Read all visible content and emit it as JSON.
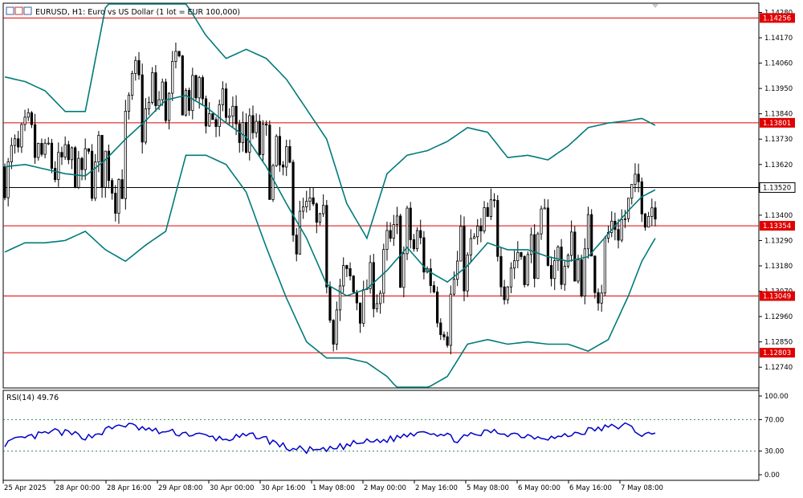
{
  "chart_data": {
    "type": "candlestick",
    "title": "EURUSD, H1:  Euro vs US Dollar (1 lot = EUR 100,000)",
    "price_axis": {
      "ylim": [
        1.1265,
        1.1432
      ],
      "ticks": [
        "1.14280",
        "1.14170",
        "1.14060",
        "1.13950",
        "1.13840",
        "1.13730",
        "1.13620",
        "1.13400",
        "1.13290",
        "1.13180",
        "1.13070",
        "1.12960",
        "1.12850",
        "1.12740"
      ]
    },
    "current_price": {
      "value": 1.1352,
      "label": "1.13520",
      "color": "#000000"
    },
    "horizontal_levels": [
      {
        "value": 1.14256,
        "label": "1.14256"
      },
      {
        "value": 1.13801,
        "label": "1.13801"
      },
      {
        "value": 1.13354,
        "label": "1.13354"
      },
      {
        "value": 1.13049,
        "label": "1.13049"
      },
      {
        "value": 1.12803,
        "label": "1.12803"
      }
    ],
    "level_color": "#e00000",
    "bollinger_color": "#007a7a",
    "bollinger_bands": {
      "middle": [
        [
          0,
          1.1361
        ],
        [
          6,
          1.1362
        ],
        [
          12,
          1.136
        ],
        [
          18,
          1.1358
        ],
        [
          24,
          1.1357
        ],
        [
          30,
          1.1364
        ],
        [
          36,
          1.1373
        ],
        [
          42,
          1.1381
        ],
        [
          48,
          1.139
        ],
        [
          54,
          1.1392
        ],
        [
          60,
          1.1387
        ],
        [
          66,
          1.138
        ],
        [
          72,
          1.1374
        ],
        [
          78,
          1.1361
        ],
        [
          84,
          1.1345
        ],
        [
          90,
          1.133
        ],
        [
          96,
          1.131
        ],
        [
          102,
          1.1305
        ],
        [
          108,
          1.1308
        ],
        [
          114,
          1.1316
        ],
        [
          120,
          1.1326
        ],
        [
          126,
          1.1316
        ],
        [
          132,
          1.1311
        ],
        [
          138,
          1.1318
        ],
        [
          144,
          1.1328
        ],
        [
          150,
          1.1325
        ],
        [
          156,
          1.1325
        ],
        [
          162,
          1.1322
        ],
        [
          168,
          1.132
        ],
        [
          174,
          1.1322
        ],
        [
          180,
          1.1332
        ],
        [
          186,
          1.1342
        ],
        [
          190,
          1.1348
        ],
        [
          194,
          1.1351
        ]
      ],
      "upper": [
        [
          0,
          1.14
        ],
        [
          6,
          1.1398
        ],
        [
          12,
          1.1394
        ],
        [
          18,
          1.1385
        ],
        [
          24,
          1.1385
        ],
        [
          30,
          1.143
        ],
        [
          36,
          1.1446
        ],
        [
          42,
          1.1447
        ],
        [
          48,
          1.144
        ],
        [
          54,
          1.1432
        ],
        [
          60,
          1.1418
        ],
        [
          66,
          1.1408
        ],
        [
          72,
          1.1412
        ],
        [
          78,
          1.1408
        ],
        [
          84,
          1.1399
        ],
        [
          90,
          1.1386
        ],
        [
          96,
          1.1373
        ],
        [
          102,
          1.1345
        ],
        [
          108,
          1.133
        ],
        [
          114,
          1.1358
        ],
        [
          120,
          1.1366
        ],
        [
          126,
          1.1368
        ],
        [
          132,
          1.1372
        ],
        [
          138,
          1.1378
        ],
        [
          144,
          1.1376
        ],
        [
          150,
          1.1365
        ],
        [
          156,
          1.1366
        ],
        [
          162,
          1.1364
        ],
        [
          168,
          1.137
        ],
        [
          174,
          1.1378
        ],
        [
          180,
          1.138
        ],
        [
          186,
          1.1381
        ],
        [
          190,
          1.1382
        ],
        [
          194,
          1.1379
        ]
      ],
      "lower": [
        [
          0,
          1.1324
        ],
        [
          6,
          1.1328
        ],
        [
          12,
          1.1328
        ],
        [
          18,
          1.1329
        ],
        [
          24,
          1.1333
        ],
        [
          30,
          1.1325
        ],
        [
          36,
          1.132
        ],
        [
          42,
          1.1327
        ],
        [
          48,
          1.1333
        ],
        [
          54,
          1.1366
        ],
        [
          60,
          1.1366
        ],
        [
          66,
          1.1362
        ],
        [
          72,
          1.135
        ],
        [
          78,
          1.1326
        ],
        [
          84,
          1.1304
        ],
        [
          90,
          1.1285
        ],
        [
          96,
          1.1278
        ],
        [
          102,
          1.1278
        ],
        [
          108,
          1.1276
        ],
        [
          114,
          1.127
        ],
        [
          120,
          1.126
        ],
        [
          126,
          1.1265
        ],
        [
          132,
          1.127
        ],
        [
          138,
          1.1284
        ],
        [
          144,
          1.1286
        ],
        [
          150,
          1.1284
        ],
        [
          156,
          1.1285
        ],
        [
          162,
          1.1284
        ],
        [
          168,
          1.1284
        ],
        [
          174,
          1.1281
        ],
        [
          180,
          1.1286
        ],
        [
          186,
          1.1305
        ],
        [
          190,
          1.132
        ],
        [
          194,
          1.133
        ]
      ]
    },
    "rsi": {
      "label": "RSI(14) 49.76",
      "ticks": [
        "100.00",
        "70.00",
        "30.00",
        "0.00"
      ],
      "levels": [
        70,
        30
      ],
      "ylim": [
        0,
        100
      ],
      "color": "#0000c8",
      "level_color": "#2e8b57"
    },
    "time_axis": [
      "25 Apr 2025",
      "28 Apr 00:00",
      "28 Apr 16:00",
      "29 Apr 08:00",
      "30 Apr 00:00",
      "30 Apr 16:00",
      "1 May 08:00",
      "2 May 00:00",
      "2 May 16:00",
      "5 May 08:00",
      "6 May 00:00",
      "6 May 16:00",
      "7 May 08:00"
    ]
  }
}
